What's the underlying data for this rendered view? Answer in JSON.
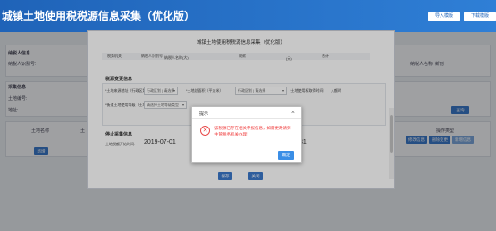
{
  "header": {
    "app_title": "城镇土地使用税税源信息采集（优化版）",
    "btn_import": "导入模版",
    "btn_download": "下载模版"
  },
  "background": {
    "label_taxpayer_info": "纳税人信息",
    "label_taxpayer_id": "纳税人识别号:",
    "label_taxpayer_name_right": "纳税人名称: 新创",
    "label_query_cond": "采集信息",
    "label_land_no": "土地编号:",
    "label_address": "地址:",
    "col_land_name": "土地名称",
    "col_col2": "土",
    "col_ops": "操作类型",
    "btn_query": "查询",
    "btn_ops_1": "修改信息",
    "btn_ops_2": "删除变更",
    "btn_ops_3": "新增信息",
    "btn_bottom": "新增"
  },
  "modal": {
    "title": "城镇土地使用税税源信息采集（优化版）",
    "header_cells": [
      "税务机关",
      "纳税人识别号",
      "纳税人名称(大)",
      "税款",
      "(元)",
      "合计"
    ],
    "section_land": "税源变更信息",
    "lbl_land_source": "*土地来源地址（行政区划）",
    "sel_land_source": "行政区划 | 请选择",
    "lbl_land_grade": "*土地总面积（平方米）",
    "sel_land_grade": "行政区划 | 请选择",
    "lbl_location": "*土地使用权取得时间",
    "val_location": "入额时",
    "lbl_land_use": "*街道土地使用等级（土地等级）",
    "sel_land_use": "请选择土地等级类型",
    "section_start": "停止采集信息",
    "lbl_start_date": "土地税额开始时间:",
    "start_date": "2019-07-01",
    "end_date_tail": "31",
    "btn_save": "保存",
    "btn_close": "关闭"
  },
  "alert": {
    "title": "提示",
    "close_glyph": "×",
    "icon": "error-x-icon",
    "line1": "该税源已存在相关申报信息，如需更改请到",
    "line2": "主管税务机关办理！",
    "ok_label": "确定"
  }
}
